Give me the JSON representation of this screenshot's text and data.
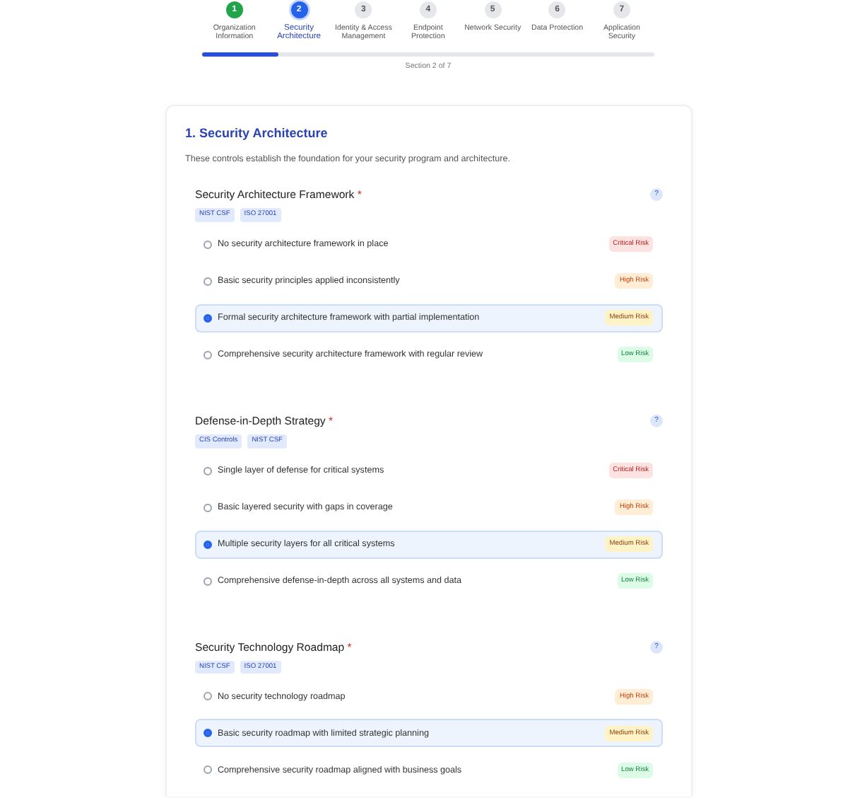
{
  "steps": [
    {
      "number": "1",
      "label": "Organization Information",
      "completed": true,
      "selected": false
    },
    {
      "number": "2",
      "label": "Security Architecture",
      "completed": false,
      "selected": true
    },
    {
      "number": "3",
      "label": "Identity & Access Management",
      "completed": false,
      "selected": false
    },
    {
      "number": "4",
      "label": "Endpoint Protection",
      "completed": false,
      "selected": false
    },
    {
      "number": "5",
      "label": "Network Security",
      "completed": false,
      "selected": false
    },
    {
      "number": "6",
      "label": "Data Protection",
      "completed": false,
      "selected": false
    },
    {
      "number": "7",
      "label": "Application Security",
      "completed": false,
      "selected": false
    }
  ],
  "progress": {
    "level": 0.17,
    "caption": "Section 2 of 7"
  },
  "section": {
    "title": "1. Security Architecture",
    "description": "These controls establish the foundation for your security program and architecture.",
    "questions": [
      {
        "title": "Security Architecture Framework",
        "required_mark": "*",
        "help": "?",
        "tags": [
          "NIST CSF",
          "ISO 27001"
        ],
        "options": [
          {
            "label": "No security architecture framework in place",
            "kind": "critical",
            "risk_label": "Critical Risk",
            "selected": false
          },
          {
            "label": "Basic security principles applied inconsistently",
            "kind": "high",
            "risk_label": "High Risk",
            "selected": false
          },
          {
            "label": "Formal security architecture framework with partial implementation",
            "kind": "medium",
            "risk_label": "Medium Risk",
            "selected": true
          },
          {
            "label": "Comprehensive security architecture framework with regular review",
            "kind": "low",
            "risk_label": "Low Risk",
            "selected": false
          }
        ]
      },
      {
        "title": "Defense-in-Depth Strategy",
        "required_mark": "*",
        "help": "?",
        "tags": [
          "CIS Controls",
          "NIST CSF"
        ],
        "options": [
          {
            "label": "Single layer of defense for critical systems",
            "kind": "critical",
            "risk_label": "Critical Risk",
            "selected": false
          },
          {
            "label": "Basic layered security with gaps in coverage",
            "kind": "high",
            "risk_label": "High Risk",
            "selected": false
          },
          {
            "label": "Multiple security layers for all critical systems",
            "kind": "medium",
            "risk_label": "Medium Risk",
            "selected": true
          },
          {
            "label": "Comprehensive defense-in-depth across all systems and data",
            "kind": "low",
            "risk_label": "Low Risk",
            "selected": false
          }
        ]
      },
      {
        "title": "Security Technology Roadmap",
        "required_mark": "*",
        "help": "?",
        "tags": [
          "NIST CSF",
          "ISO 27001"
        ],
        "options": [
          {
            "label": "No security technology roadmap",
            "kind": "high",
            "risk_label": "High Risk",
            "selected": false
          },
          {
            "label": "Basic security roadmap with limited strategic planning",
            "kind": "medium",
            "risk_label": "Medium Risk",
            "selected": true
          },
          {
            "label": "Comprehensive security roadmap aligned with business goals",
            "kind": "low",
            "risk_label": "Low Risk",
            "selected": false
          }
        ]
      }
    ]
  }
}
